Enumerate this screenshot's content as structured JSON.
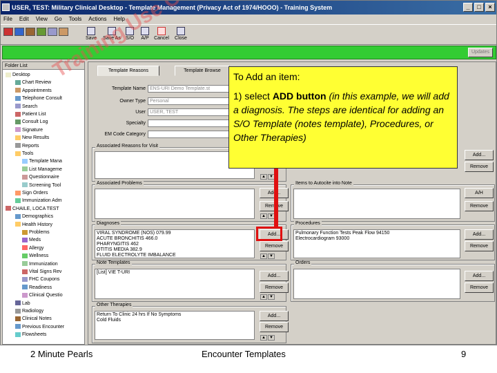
{
  "window": {
    "title": "USER, TEST: Military Clinical Desktop - Template Management (Privacy Act of 1974/HOOO) - Training System",
    "controls": [
      "_",
      "□",
      "×"
    ]
  },
  "menu": [
    "File",
    "Edit",
    "View",
    "Go",
    "Tools",
    "Actions",
    "Help"
  ],
  "toolbar": {
    "buttons": [
      "Save",
      "Save As",
      "S/O",
      "A/P",
      "Cancel",
      "Close"
    ]
  },
  "greenbar": {
    "updates_label": "Updates"
  },
  "left_panel": {
    "header": "Folder List",
    "items": [
      "Desktop",
      "Chart Review",
      "Appointments",
      "Telephone Consult",
      "Search",
      "Patient List",
      "Consult Log",
      "Signature",
      "New Results",
      "Reports",
      "Tools",
      "Template Mana",
      "List Manageme",
      "Questionnaire",
      "Screening Tool",
      "Sign Orders",
      "Immunization Adm",
      "CHAILE, LOCA TEST",
      "Demographics",
      "Health History",
      "Problems",
      "Meds",
      "Allergy",
      "Wellness",
      "Immunization",
      "Vital Signs Rev",
      "FHC Coupons",
      "Readiness",
      "Clinical Questio",
      "Lab",
      "Radiology",
      "Clinical Notes",
      "Previous Encounter",
      "Flowsheets"
    ]
  },
  "tabs": [
    "Template Reasons",
    "Template Browse"
  ],
  "form": {
    "template_name_label": "Template Name",
    "template_name_value": "ENS-URI Demo Template.st",
    "owner_type_label": "Owner Type",
    "owner_type_value": "Personal",
    "user_label": "User",
    "user_value": "USER, TEST",
    "specialty_label": "Specialty",
    "em_code_label": "EM Code Category"
  },
  "sections": {
    "reasons_for_visit": {
      "title": "Associated Reasons for Visit",
      "items": [],
      "add": "Add...",
      "remove": "Remove"
    },
    "problems": {
      "title": "Associated Problems",
      "items": [],
      "add": "Add...",
      "remove": "Remove"
    },
    "items_to_autocite": {
      "title": "Items to Autocite into Note",
      "items": [],
      "add": "A/H",
      "remove": "Remove"
    },
    "diagnoses": {
      "title": "Diagnoses",
      "items": [
        "VIRAL SYNDROME (NOS) 079.99",
        "ACUTE BRONCHITIS 466.0",
        "PHARYNGITIS 462",
        "OTITIS MEDIA 382.9",
        "FLUID ELECTROLYTE IMBALANCE"
      ],
      "add": "Add...",
      "remove": "Remove"
    },
    "procedures": {
      "title": "Procedures",
      "items": [
        "Pulmonary Function Tests Peak Flow 94150",
        "Electrocardiogram 93000"
      ],
      "add": "Add...",
      "remove": "Remove"
    },
    "note_templates": {
      "title": "Note Templates",
      "items": [
        "[List] VIE T-URI"
      ],
      "add": "Add...",
      "remove": "Remove"
    },
    "orders": {
      "title": "Orders",
      "items": [],
      "add": "Add...",
      "remove": "Remove"
    },
    "other_therapies": {
      "title": "Other Therapies",
      "items": [
        "Return To Clinic 24 hrs If No Symptoms",
        "Cold Fluids"
      ],
      "add": "Add...",
      "remove": "Remove"
    }
  },
  "callout": {
    "title": "To Add an item:",
    "step_prefix": "1) select",
    "step_bold": "ADD button",
    "step_italic": "(in this example, we will add a diagnosis.  The steps are identical for adding an S/O Template (notes template), Procedures, or Other Therapies)"
  },
  "watermark": "Training Use Only",
  "footer": {
    "left": "2 Minute Pearls",
    "center": "Encounter Templates",
    "right": "9"
  },
  "colors": {
    "title_bar": "#0a246a",
    "green_bar": "#33cc33",
    "callout_bg": "#ffff33",
    "highlight_red": "#e01010"
  }
}
